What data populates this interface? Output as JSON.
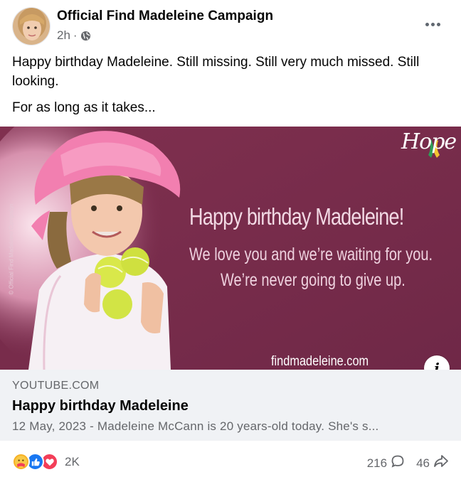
{
  "post": {
    "page_name": "Official Find Madeleine Campaign",
    "time": "2h",
    "separator": "·",
    "caption_line1": "Happy birthday Madeleine. Still missing. Still very much missed. Still looking.",
    "caption_line2": "For as long as it takes..."
  },
  "preview_image": {
    "watermark": "© Official Find Madeleine Campaign",
    "hope_text": "Hope",
    "title": "Happy birthday Madeleine!",
    "line1": "We love you and we’re waiting for you.",
    "line2": "We’re never going to give up.",
    "site": "findmadeleine.com",
    "info": "i"
  },
  "link": {
    "domain": "YOUTUBE.COM",
    "title": "Happy birthday Madeleine",
    "description": "12 May, 2023 - Madeleine McCann is 20 years-old today. She's s..."
  },
  "footer": {
    "reaction_count": "2K",
    "comment_count": "216",
    "share_count": "46"
  },
  "colors": {
    "preview_bg": "#7a2d4f",
    "link_meta_bg": "#f0f2f5",
    "like": "#1877f2",
    "love": "#f33e58",
    "care": "#f7b125"
  },
  "icons": [
    "globe-icon",
    "more-options-icon",
    "info-icon",
    "care-reaction-icon",
    "like-reaction-icon",
    "love-reaction-icon",
    "comment-icon",
    "share-icon",
    "hope-ribbon-icon"
  ]
}
